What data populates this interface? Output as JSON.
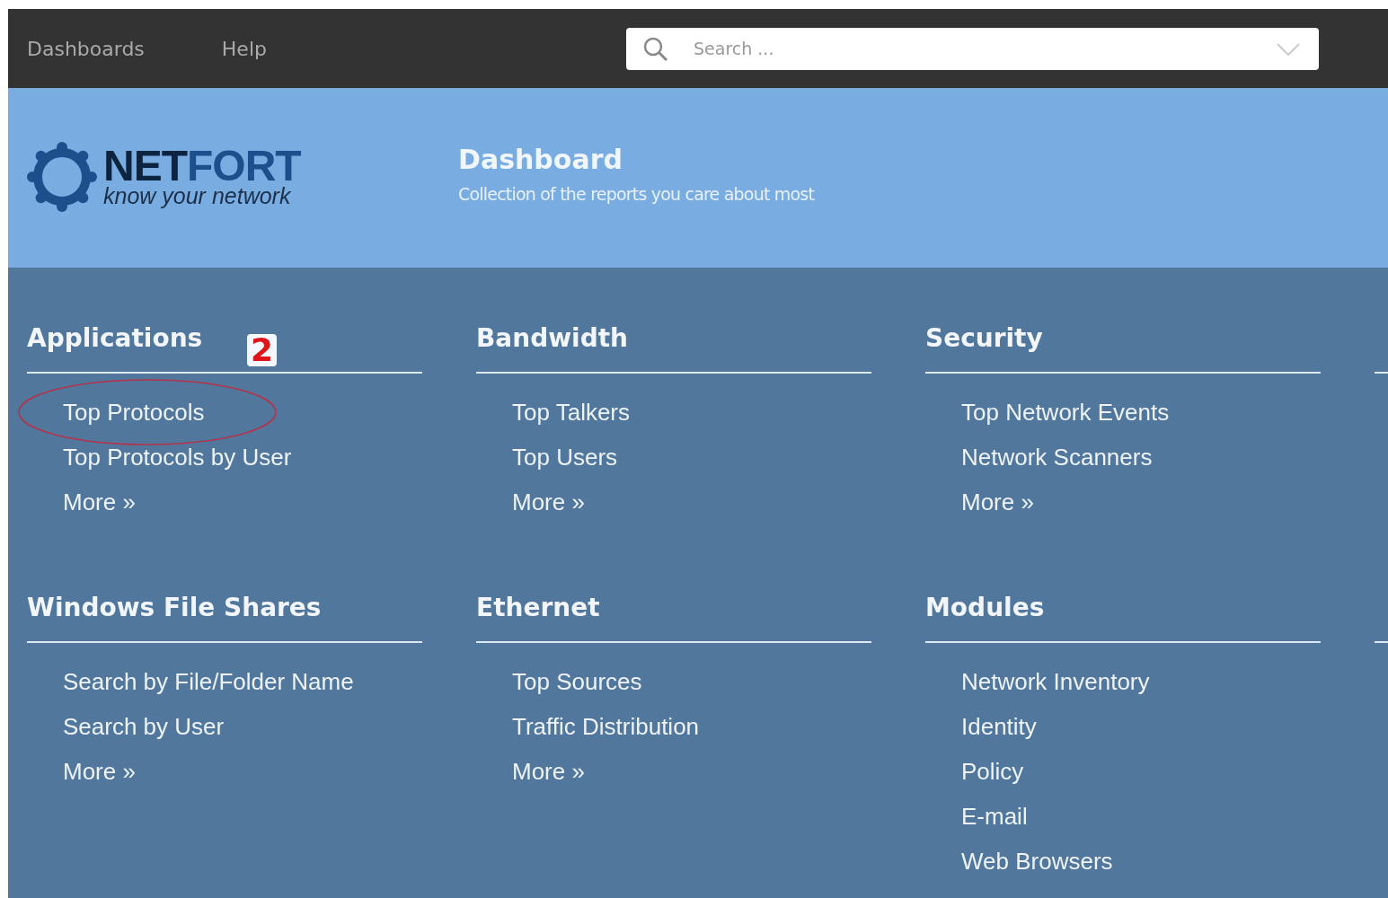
{
  "nav": {
    "items": [
      {
        "label": "Dashboards"
      },
      {
        "label": "Help"
      }
    ]
  },
  "search": {
    "placeholder": "Search ..."
  },
  "logo": {
    "wordmark_dark": "NET",
    "wordmark_light": "FORT",
    "tagline": "know your network"
  },
  "header": {
    "title": "Dashboard",
    "subtitle": "Collection of the reports you care about most"
  },
  "sections": [
    {
      "title": "Applications",
      "links": [
        "Top Protocols",
        "Top Protocols by User",
        "More »"
      ]
    },
    {
      "title": "Bandwidth",
      "links": [
        "Top Talkers",
        "Top Users",
        "More »"
      ]
    },
    {
      "title": "Security",
      "links": [
        "Top Network Events",
        "Network Scanners",
        "More »"
      ]
    },
    {
      "title": "Windows File Shares",
      "links": [
        "Search by File/Folder Name",
        "Search by User",
        "More »"
      ]
    },
    {
      "title": "Ethernet",
      "links": [
        "Top Sources",
        "Traffic Distribution",
        "More »"
      ]
    },
    {
      "title": "Modules",
      "links": [
        "Network Inventory",
        "Identity",
        "Policy",
        "E-mail",
        "Web Browsers"
      ]
    }
  ],
  "annotation": {
    "label": "2"
  }
}
